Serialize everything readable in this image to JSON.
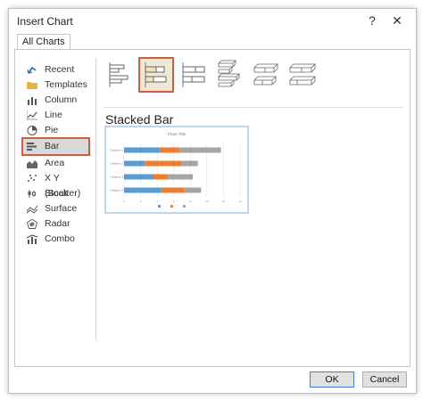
{
  "window": {
    "title": "Insert Chart",
    "help_label": "?",
    "close_label": "✕"
  },
  "tabs": [
    {
      "label": "All Charts",
      "active": true
    }
  ],
  "sidebar": {
    "items": [
      {
        "label": "Recent",
        "icon": "recent-icon"
      },
      {
        "label": "Templates",
        "icon": "templates-icon"
      },
      {
        "label": "Column",
        "icon": "column-chart-icon"
      },
      {
        "label": "Line",
        "icon": "line-chart-icon"
      },
      {
        "label": "Pie",
        "icon": "pie-chart-icon"
      },
      {
        "label": "Bar",
        "icon": "bar-chart-icon",
        "selected": true
      },
      {
        "label": "Area",
        "icon": "area-chart-icon"
      },
      {
        "label": "X Y (Scatter)",
        "icon": "scatter-chart-icon"
      },
      {
        "label": "Stock",
        "icon": "stock-chart-icon"
      },
      {
        "label": "Surface",
        "icon": "surface-chart-icon"
      },
      {
        "label": "Radar",
        "icon": "radar-chart-icon"
      },
      {
        "label": "Combo",
        "icon": "combo-chart-icon"
      }
    ]
  },
  "subtypes": [
    {
      "name": "clustered-bar",
      "selected": false
    },
    {
      "name": "stacked-bar",
      "selected": true
    },
    {
      "name": "100-stacked-bar",
      "selected": false
    },
    {
      "name": "3d-clustered-bar",
      "selected": false
    },
    {
      "name": "3d-stacked-bar",
      "selected": false
    },
    {
      "name": "3d-100-stacked-bar",
      "selected": false
    }
  ],
  "selected_type_title": "Stacked Bar",
  "preview": {
    "title": "Chart Title",
    "categories": [
      "Category 1",
      "Category 2",
      "Category 3",
      "Category 4"
    ],
    "series": [
      {
        "values": [
          4.3,
          2.5,
          3.5,
          4.5
        ],
        "color": "#5b9bd5"
      },
      {
        "values": [
          2.4,
          4.4,
          1.8,
          2.8
        ],
        "color": "#ed7d31"
      },
      {
        "values": [
          5,
          2,
          3,
          2
        ],
        "color": "#a5a5a5"
      }
    ],
    "ticks": [
      "0",
      "2",
      "4",
      "6",
      "8",
      "10",
      "12",
      "14"
    ],
    "xmax": 14
  },
  "buttons": {
    "ok": "OK",
    "cancel": "Cancel"
  },
  "colors": {
    "selection_border": "#cd5e3c",
    "primary_border": "#3b7dd8"
  }
}
